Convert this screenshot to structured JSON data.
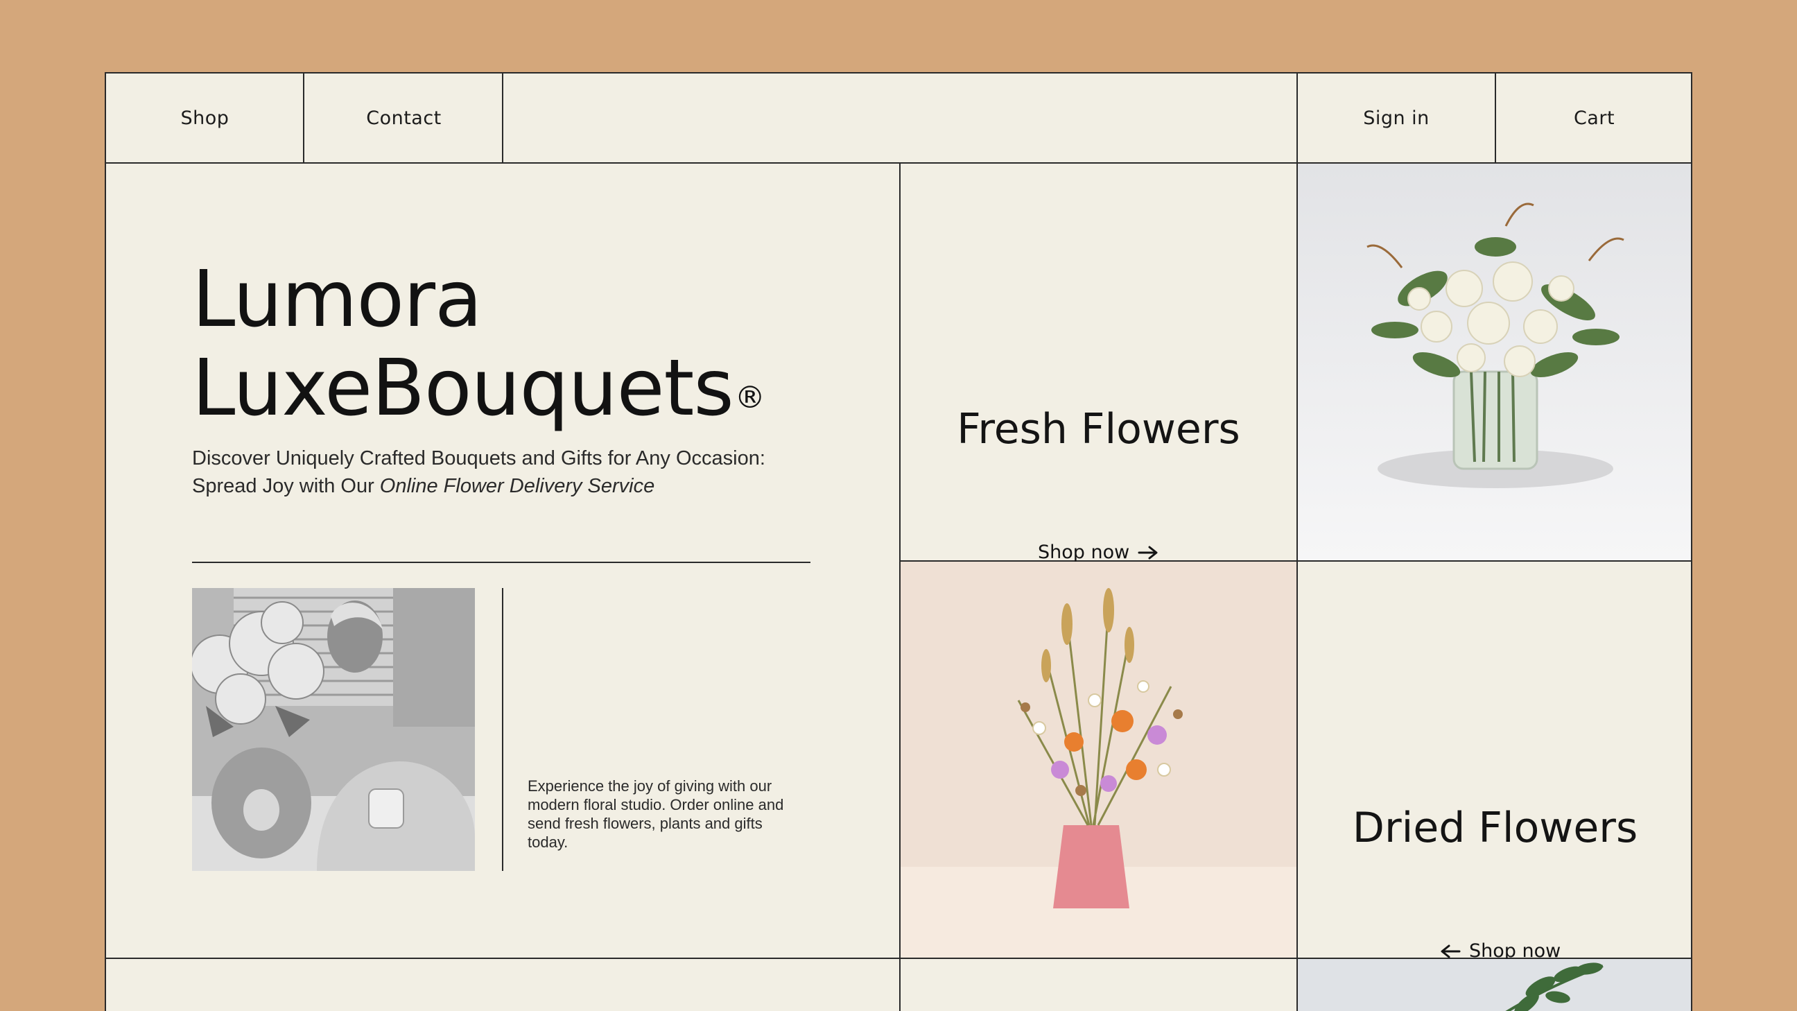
{
  "nav": {
    "shop": "Shop",
    "contact": "Contact",
    "sign_in": "Sign in",
    "cart": "Cart"
  },
  "hero": {
    "brand_line1": "Lumora",
    "brand_line2": "LuxeBouquets",
    "registered_mark": "®",
    "tagline_part1": "Discover Uniquely Crafted Bouquets and Gifts for Any Occasion:",
    "tagline_part2": "Spread Joy with Our ",
    "tagline_emphasis": "Online Flower Delivery Service",
    "description": "Experience the joy of giving with our modern floral studio. Order online and send fresh flowers, plants and gifts today."
  },
  "categories": [
    {
      "title": "Fresh Flowers",
      "cta": "Shop now",
      "arrow": "arrow-right-icon"
    },
    {
      "title": "Dried Flowers",
      "cta": "Shop now",
      "arrow": "arrow-left-icon"
    }
  ],
  "colors": {
    "frame_background": "#d4a77b",
    "page_background": "#f2efe4",
    "border": "#2a2a2a",
    "text": "#141414"
  }
}
